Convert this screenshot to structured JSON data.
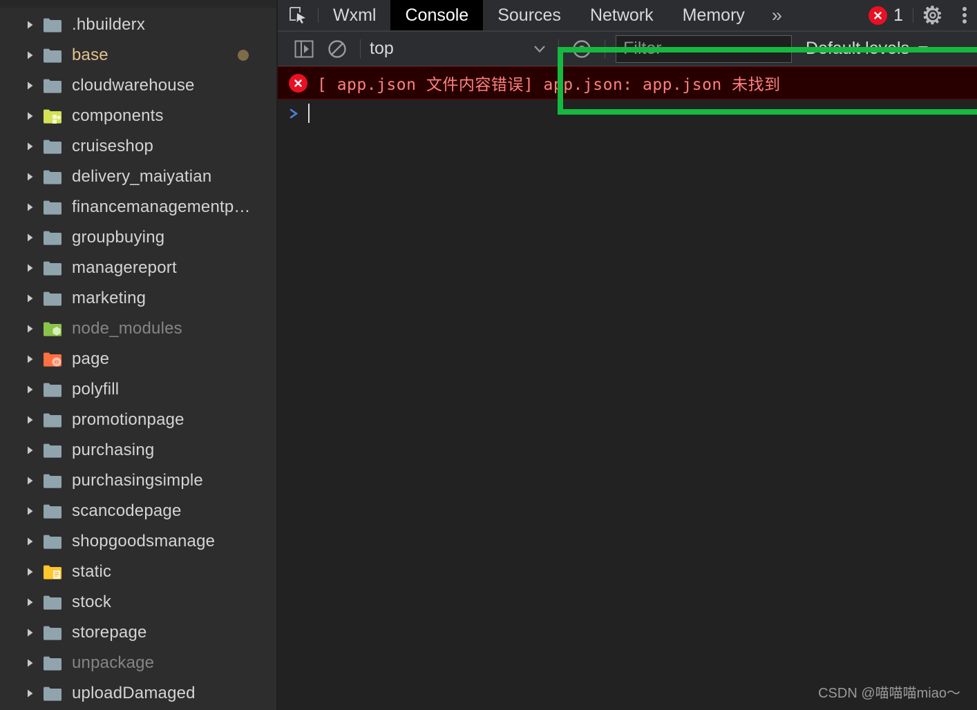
{
  "colors": {
    "sidebar_bg": "#2d2d2d",
    "panel_bg": "#222222",
    "toolbar_bg": "#2b2d31",
    "active_tab_bg": "#000000",
    "error_row_bg": "#290000",
    "error_row_border": "#5c0000",
    "error_text": "#ff8080",
    "error_badge": "#e81123",
    "annotation_green": "#16b93f",
    "folder_default": "#90a4ae",
    "folder_components": "#d4e157",
    "folder_node_modules": "#8bc34a",
    "folder_page": "#ff7043",
    "folder_static": "#ffc62e",
    "modified_label": "#e2c08d",
    "ignored_label": "#858585"
  },
  "sidebar": {
    "items": [
      {
        "label": ".hbuilderx",
        "icon": "folder-icon",
        "state": "normal",
        "dot": false
      },
      {
        "label": "base",
        "icon": "folder-icon",
        "state": "modified",
        "dot": true
      },
      {
        "label": "cloudwarehouse",
        "icon": "folder-icon",
        "state": "normal",
        "dot": false
      },
      {
        "label": "components",
        "icon": "folder-components-icon",
        "state": "normal",
        "dot": false
      },
      {
        "label": "cruiseshop",
        "icon": "folder-icon",
        "state": "normal",
        "dot": false
      },
      {
        "label": "delivery_maiyatian",
        "icon": "folder-icon",
        "state": "normal",
        "dot": false
      },
      {
        "label": "financemanagementp…",
        "icon": "folder-icon",
        "state": "normal",
        "dot": false
      },
      {
        "label": "groupbuying",
        "icon": "folder-icon",
        "state": "normal",
        "dot": false
      },
      {
        "label": "managereport",
        "icon": "folder-icon",
        "state": "normal",
        "dot": false
      },
      {
        "label": "marketing",
        "icon": "folder-icon",
        "state": "normal",
        "dot": false
      },
      {
        "label": "node_modules",
        "icon": "folder-node-modules-icon",
        "state": "ignored",
        "dot": false
      },
      {
        "label": "page",
        "icon": "folder-page-icon",
        "state": "normal",
        "dot": false
      },
      {
        "label": "polyfill",
        "icon": "folder-icon",
        "state": "normal",
        "dot": false
      },
      {
        "label": "promotionpage",
        "icon": "folder-icon",
        "state": "normal",
        "dot": false
      },
      {
        "label": "purchasing",
        "icon": "folder-icon",
        "state": "normal",
        "dot": false
      },
      {
        "label": "purchasingsimple",
        "icon": "folder-icon",
        "state": "normal",
        "dot": false
      },
      {
        "label": "scancodepage",
        "icon": "folder-icon",
        "state": "normal",
        "dot": false
      },
      {
        "label": "shopgoodsmanage",
        "icon": "folder-icon",
        "state": "normal",
        "dot": false
      },
      {
        "label": "static",
        "icon": "folder-static-icon",
        "state": "normal",
        "dot": false
      },
      {
        "label": "stock",
        "icon": "folder-icon",
        "state": "normal",
        "dot": false
      },
      {
        "label": "storepage",
        "icon": "folder-icon",
        "state": "normal",
        "dot": false
      },
      {
        "label": "unpackage",
        "icon": "folder-icon",
        "state": "ignored",
        "dot": false
      },
      {
        "label": "uploadDamaged",
        "icon": "folder-icon",
        "state": "normal",
        "dot": false
      }
    ]
  },
  "devtools": {
    "tabs": [
      {
        "label": "Wxml",
        "active": false
      },
      {
        "label": "Console",
        "active": true
      },
      {
        "label": "Sources",
        "active": false
      },
      {
        "label": "Network",
        "active": false
      },
      {
        "label": "Memory",
        "active": false
      }
    ],
    "more_tabs_label": "»",
    "error_badge_count": "1",
    "toolbar": {
      "context_value": "top",
      "filter_placeholder": "Filter",
      "levels_label": "Default levels"
    },
    "messages": [
      {
        "level": "error",
        "text": "[ app.json 文件内容错误] app.json: app.json 未找到"
      }
    ],
    "prompt_symbol": ">"
  },
  "watermark": {
    "text": "CSDN @喵喵喵miao～"
  }
}
